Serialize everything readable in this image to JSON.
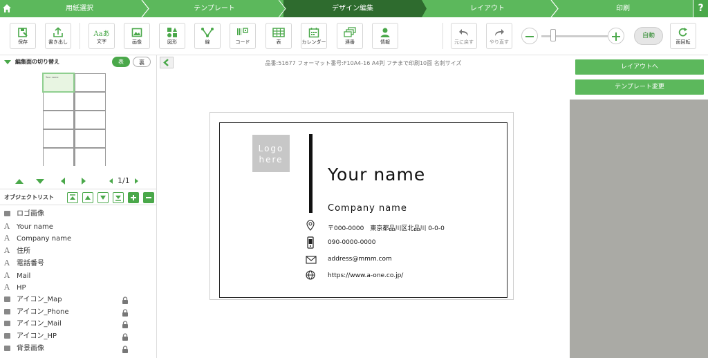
{
  "steps": [
    "用紙選択",
    "テンプレート",
    "デザイン編集",
    "レイアウト",
    "印刷"
  ],
  "active_step": "デザイン編集",
  "help_label": "?",
  "toolbar": {
    "save": "保存",
    "export": "書き出し",
    "text": "文字",
    "text_icon": "Aaあ",
    "image": "画像",
    "shape": "図形",
    "line": "線",
    "code": "コード",
    "table": "表",
    "calendar": "カレンダー",
    "serial": "連番",
    "info": "情報",
    "undo": "元に戻す",
    "redo": "やり直す",
    "auto": "自動",
    "rotate": "面回転"
  },
  "zoom_level": 0.14,
  "left": {
    "switch_title": "編集面の切り替え",
    "front": "表",
    "back": "裏",
    "page_indicator": "1/1",
    "mini_card_name": "Your name",
    "object_list_title": "オブジェクトリスト",
    "objects": [
      {
        "type": "image",
        "name": "ロゴ画像",
        "locked": false
      },
      {
        "type": "text",
        "name": "Your name",
        "locked": false
      },
      {
        "type": "text",
        "name": "Company name",
        "locked": false
      },
      {
        "type": "text",
        "name": "住所",
        "locked": false
      },
      {
        "type": "text",
        "name": "電話番号",
        "locked": false
      },
      {
        "type": "text",
        "name": "Mail",
        "locked": false
      },
      {
        "type": "text",
        "name": "HP",
        "locked": false
      },
      {
        "type": "image",
        "name": "アイコン_Map",
        "locked": true
      },
      {
        "type": "image",
        "name": "アイコン_Phone",
        "locked": true
      },
      {
        "type": "image",
        "name": "アイコン_Mail",
        "locked": true
      },
      {
        "type": "image",
        "name": "アイコン_HP",
        "locked": true
      },
      {
        "type": "image",
        "name": "背景画像",
        "locked": true
      }
    ]
  },
  "canvas": {
    "product_info": "品番:51677 フォーマット番号:F10A4-16 A4判 フチまで印刷10面 名刺サイズ",
    "card": {
      "logo_line1": "Logo",
      "logo_line2": "here",
      "your_name": "Your name",
      "company_name": "Company name",
      "address": "〒000-0000　東京都品川区北品川 0-0-0",
      "phone": "090-0000-0000",
      "email": "address@mmm.com",
      "url": "https://www.a-one.co.jp/"
    }
  },
  "right": {
    "layout_button": "レイアウトへ",
    "template_button": "テンプレート変更"
  },
  "colors": {
    "accent": "#5cb85c",
    "active_step": "#2e6b2e",
    "panel_grey": "#aaaaa5"
  }
}
